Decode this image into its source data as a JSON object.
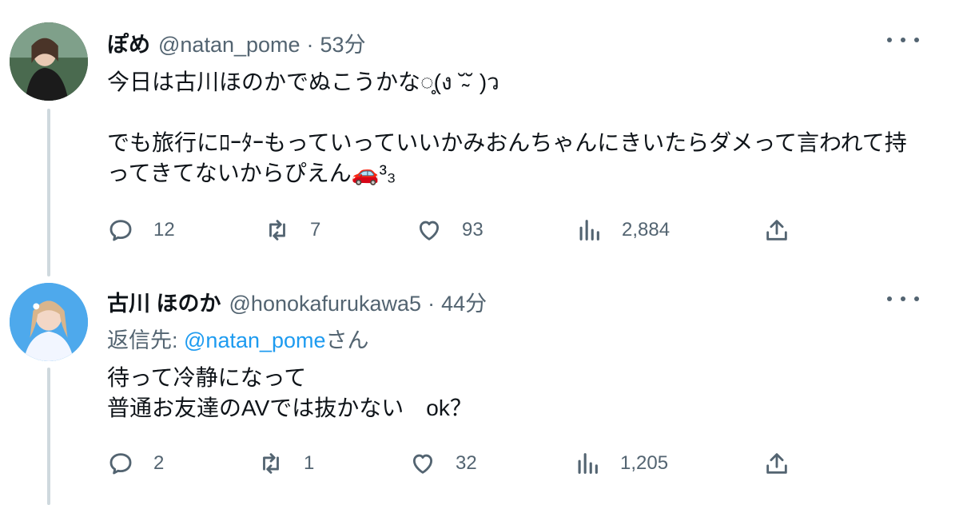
{
  "tweets": [
    {
      "name": "ぽめ",
      "handle": "@natan_pome",
      "separator": "·",
      "time": "53分",
      "body": "今日は古川ほのかでぬこうかな◌̥̥(ง ˘̴˘ )ว\n\nでも旅行にﾛｰﾀｰもっていっていいかみおんちゃんにきいたらダメって言われて持ってきてないからぴえん🚗³₃",
      "replies": "12",
      "retweets": "7",
      "likes": "93",
      "views": "2,884"
    },
    {
      "name": "古川 ほのか",
      "handle": "@honokafurukawa5",
      "separator": "·",
      "time": "44分",
      "reply_prefix": "返信先: ",
      "reply_mention": "@natan_pome",
      "reply_suffix": "さん",
      "body": "待って冷静になって\n普通お友達のAVでは抜かない　ok？",
      "replies": "2",
      "retweets": "1",
      "likes": "32",
      "views": "1,205"
    }
  ],
  "icons": {
    "reply": "speech-bubble-icon",
    "retweet": "retweet-icon",
    "like": "heart-icon",
    "views": "bar-chart-icon",
    "share": "share-upload-icon",
    "more": "more-dots-icon"
  },
  "colors": {
    "text": "#0f1419",
    "muted": "#536471",
    "link": "#1d9bf0",
    "thread": "#cfd9de"
  }
}
